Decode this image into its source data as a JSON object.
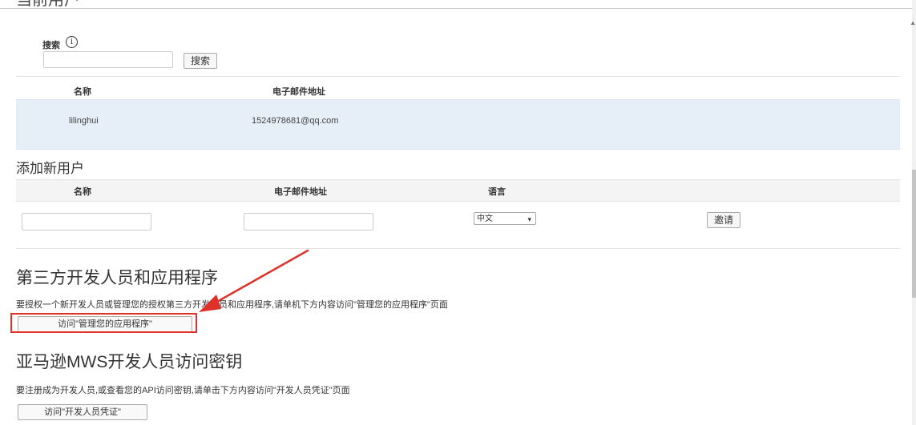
{
  "current_users": {
    "title_partial": "当前用户",
    "search_label": "搜索",
    "search_value": "",
    "search_button": "搜索",
    "columns": [
      "名称",
      "电子邮件地址"
    ],
    "rows": [
      {
        "name": "lilinghui",
        "email": "1524978681@qq.com"
      }
    ]
  },
  "add_user": {
    "title": "添加新用户",
    "columns": [
      "名称",
      "电子邮件地址",
      "语言"
    ],
    "name_value": "",
    "email_value": "",
    "language_selected": "中文",
    "invite_button": "邀请"
  },
  "third_party": {
    "title": "第三方开发人员和应用程序",
    "description": "要授权一个新开发人员或管理您的授权第三方开发人员和应用程序,请单机下方内容访问\"管理您的应用程序\"页面",
    "button": "访问\"管理您的应用程序\""
  },
  "mws": {
    "title": "亚马逊MWS开发人员访问密钥",
    "description": "要注册成为开发人员,或查看您的API访问密钥,请单击下方内容访问\"开发人员凭证\"页面",
    "button": "访问\"开发人员凭证\""
  },
  "annotation": {
    "color": "#e0302a",
    "icon": "red-arrow-annotation"
  }
}
